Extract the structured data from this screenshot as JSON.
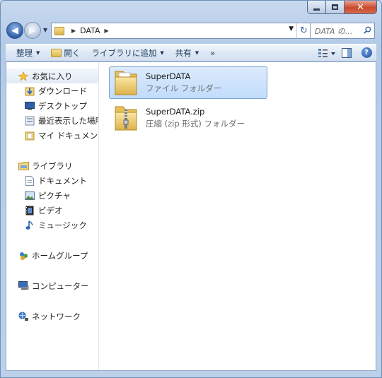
{
  "window": {
    "caption": {
      "minimize": "–",
      "maximize": "□",
      "close": "✕"
    }
  },
  "address": {
    "path": [
      "DATA"
    ],
    "search_placeholder": "DATA の..."
  },
  "toolbar": {
    "organize": "整理",
    "open": "開く",
    "add_to_library": "ライブラリに追加",
    "share": "共有",
    "more": "»"
  },
  "nav": {
    "favorites": {
      "label": "お気に入り",
      "items": [
        "ダウンロード",
        "デスクトップ",
        "最近表示した場所",
        "マイ ドキュメント"
      ]
    },
    "libraries": {
      "label": "ライブラリ",
      "items": [
        "ドキュメント",
        "ピクチャ",
        "ビデオ",
        "ミュージック"
      ]
    },
    "homegroup": "ホームグループ",
    "computer": "コンピューター",
    "network": "ネットワーク"
  },
  "files": [
    {
      "name": "SuperDATA",
      "type": "ファイル フォルダー",
      "icon": "folder-icon",
      "selected": true
    },
    {
      "name": "SuperDATA.zip",
      "type": "圧縮 (zip 形式) フォルダー",
      "icon": "zip-folder-icon",
      "selected": false
    }
  ],
  "colors": {
    "accent": "#3b66a6",
    "selection": "#c1dcfc",
    "close_button": "#c94a2b"
  }
}
